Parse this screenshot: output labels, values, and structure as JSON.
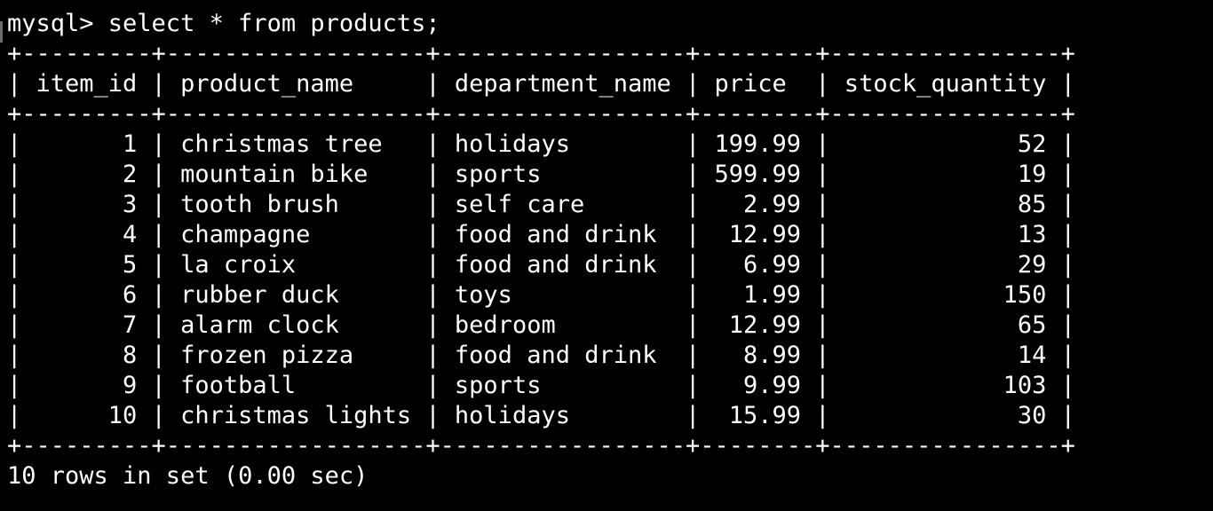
{
  "terminal": {
    "prompt": "mysql>",
    "command": "select * from products;",
    "columns": [
      "item_id",
      "product_name",
      "department_name",
      "price",
      "stock_quantity"
    ],
    "rows": [
      [
        "1",
        "christmas tree",
        "holidays",
        "199.99",
        "52"
      ],
      [
        "2",
        "mountain bike",
        "sports",
        "599.99",
        "19"
      ],
      [
        "3",
        "tooth brush",
        "self care",
        "2.99",
        "85"
      ],
      [
        "4",
        "champagne",
        "food and drink",
        "12.99",
        "13"
      ],
      [
        "5",
        "la croix",
        "food and drink",
        "6.99",
        "29"
      ],
      [
        "6",
        "rubber duck",
        "toys",
        "1.99",
        "150"
      ],
      [
        "7",
        "alarm clock",
        "bedroom",
        "12.99",
        "65"
      ],
      [
        "8",
        "frozen pizza",
        "food and drink",
        "8.99",
        "14"
      ],
      [
        "9",
        "football",
        "sports",
        "9.99",
        "103"
      ],
      [
        "10",
        "christmas lights",
        "holidays",
        "15.99",
        "30"
      ]
    ],
    "footer": "10 rows in set (0.00 sec)",
    "colors": {
      "background": "#000000",
      "text": "#ffffff",
      "cursor": "#6a6a6a"
    }
  }
}
